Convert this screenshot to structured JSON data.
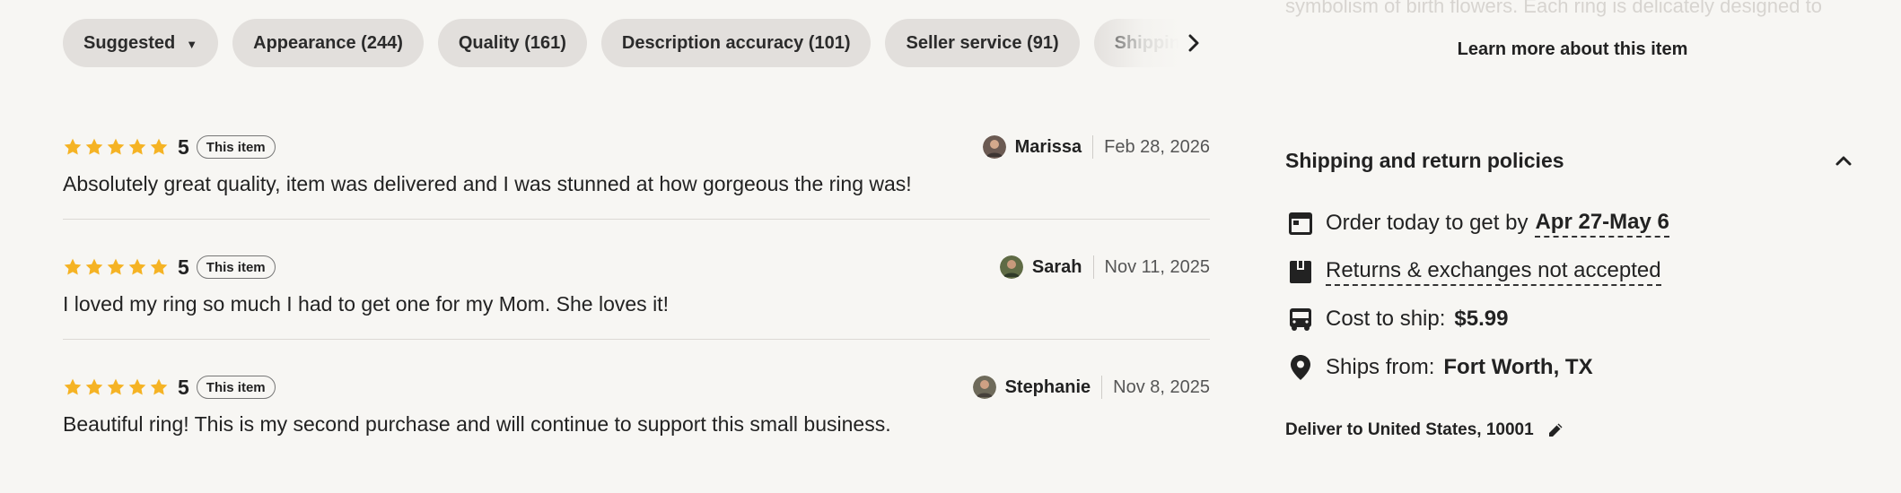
{
  "filters": {
    "chips": [
      {
        "label": "Suggested"
      },
      {
        "label": "Appearance (244)"
      },
      {
        "label": "Quality (161)"
      },
      {
        "label": "Description accuracy (101)"
      },
      {
        "label": "Seller service (91)"
      },
      {
        "label": "Shipping & P"
      }
    ]
  },
  "reviews": [
    {
      "rating": "5",
      "badge": "This item",
      "reviewer": "Marissa",
      "date": "Feb 28, 2026",
      "text": "Absolutely great quality, item was delivered and I was stunned at how gorgeous the ring was!"
    },
    {
      "rating": "5",
      "badge": "This item",
      "reviewer": "Sarah",
      "date": "Nov 11, 2025",
      "text": "I loved my ring so much I had to get one for my Mom. She loves it!"
    },
    {
      "rating": "5",
      "badge": "This item",
      "reviewer": "Stephanie",
      "date": "Nov 8, 2025",
      "text": "Beautiful ring! This is my second purchase and will continue to support this small business."
    }
  ],
  "details": {
    "faded_text": "symbolism of birth flowers. Each ring is delicately designed to",
    "learn_more": "Learn more about this item"
  },
  "shipping": {
    "title": "Shipping and return policies",
    "order_label": "Order today to get by",
    "order_dates": "Apr 27-May 6",
    "returns": "Returns & exchanges not accepted",
    "cost_label": "Cost to ship:",
    "cost_value": "$5.99",
    "from_label": "Ships from:",
    "from_value": "Fort Worth, TX",
    "deliver_to": "Deliver to United States, 10001"
  },
  "colors": {
    "star": "#f5b324",
    "page_bg": "#f7f6f3",
    "chip_bg": "#e2dfdc"
  },
  "icons": [
    "caret-down-icon",
    "chevron-right-icon",
    "star-icon",
    "chevron-up-icon",
    "calendar-icon",
    "return-box-icon",
    "truck-icon",
    "location-pin-icon",
    "pencil-icon"
  ]
}
